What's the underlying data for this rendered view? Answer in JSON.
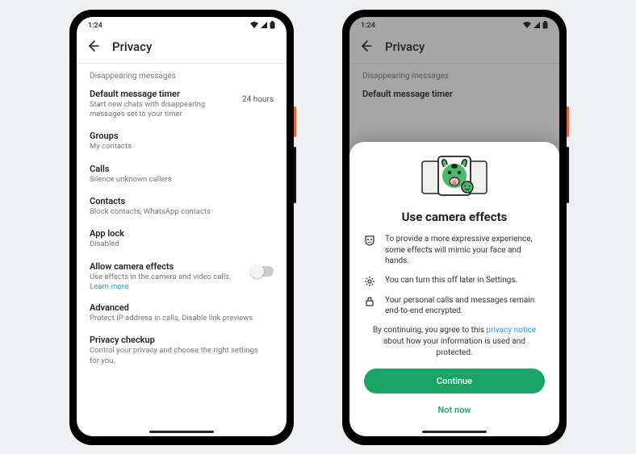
{
  "status": {
    "time": "1:24",
    "wifi": "▾",
    "signal": "◢",
    "battery": "▮"
  },
  "header": {
    "title": "Privacy"
  },
  "sectionLabel": "Disappearing messages",
  "timer": {
    "title": "Default message timer",
    "sub": "Start new chats with disappearing messages set to your timer",
    "value": "24 hours"
  },
  "groups": {
    "title": "Groups",
    "sub": "My contacts"
  },
  "calls": {
    "title": "Calls",
    "sub": "Silence unknown callers"
  },
  "contacts": {
    "title": "Contacts",
    "sub": "Block contacts, WhatsApp contacts"
  },
  "applock": {
    "title": "App lock",
    "sub": "Disabled"
  },
  "camera": {
    "title": "Allow camera effects",
    "sub": "Use effects in the camera and video calls.",
    "link": "Learn more"
  },
  "advanced": {
    "title": "Advanced",
    "sub": "Protect IP address in calls, Disable link previews"
  },
  "checkup": {
    "title": "Privacy checkup",
    "sub": "Control your privacy and choose the right settings for you."
  },
  "sheet": {
    "title": "Use camera effects",
    "b1": "To provide a more expressive experience, some effects will mimic your face and hands.",
    "b2": "You can turn this off later in Settings.",
    "b3": "Your personal calls and messages remain end-to-end encrypted.",
    "consentPre": "By continuing, you agree to this ",
    "consentLink": "privacy notice",
    "consentPost": " about how your information is used and protected.",
    "continue": "Continue",
    "notnow": "Not now"
  }
}
